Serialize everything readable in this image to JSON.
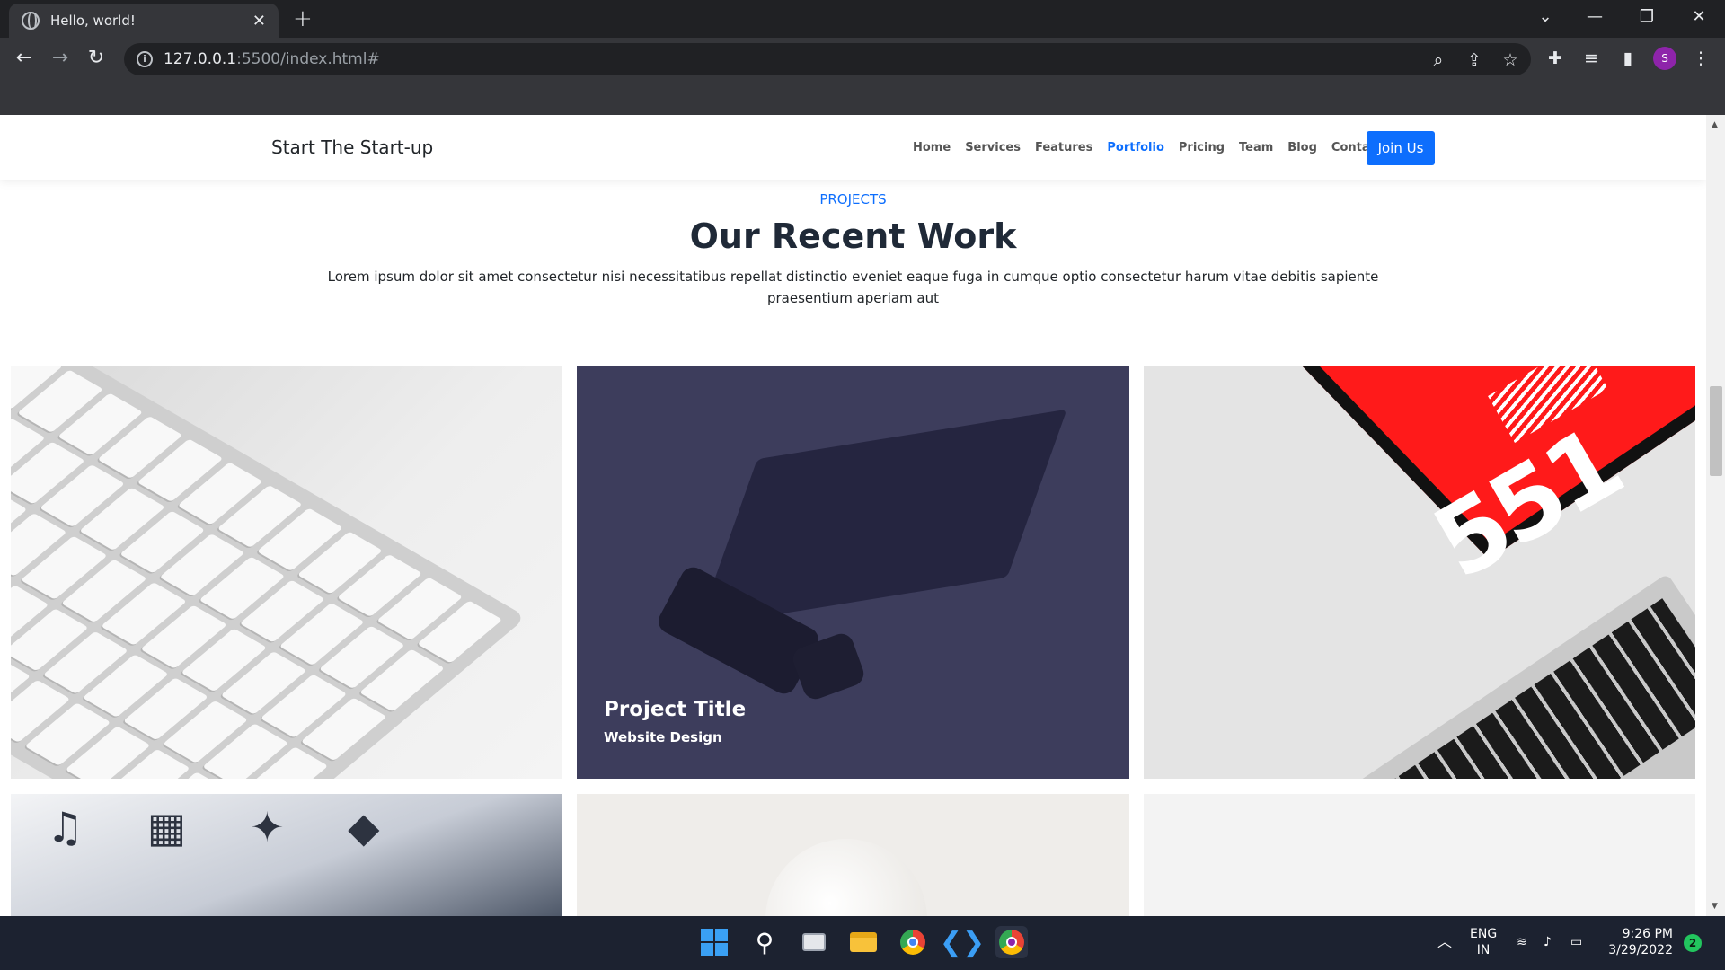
{
  "browser": {
    "tab_title": "Hello, world!",
    "tab_close": "✕",
    "new_tab": "+",
    "url_host": "127.0.0.1",
    "url_rest": ":5500/index.html#",
    "profile_initial": "S"
  },
  "site": {
    "brand": "Start The Start-up",
    "nav": [
      "Home",
      "Services",
      "Features",
      "Portfolio",
      "Pricing",
      "Team",
      "Blog",
      "Contact"
    ],
    "active_nav": "Portfolio",
    "cta": "Join Us",
    "accent": "#0d6efd"
  },
  "portfolio": {
    "eyebrow": "PROJECTS",
    "heading": "Our Recent Work",
    "lead": "Lorem ipsum dolor sit amet consectetur nisi necessitatibus repellat distinctio eveniet eaque fuga in cumque optio consectetur harum vitae debitis sapiente praesentium aperiam aut",
    "featured": {
      "title": "Project Title",
      "subtitle": "Website Design"
    },
    "screen_text": "551"
  },
  "taskbar": {
    "lang": "ENG",
    "region": "IN",
    "time": "9:26 PM",
    "date": "3/29/2022",
    "notifications": "2"
  }
}
